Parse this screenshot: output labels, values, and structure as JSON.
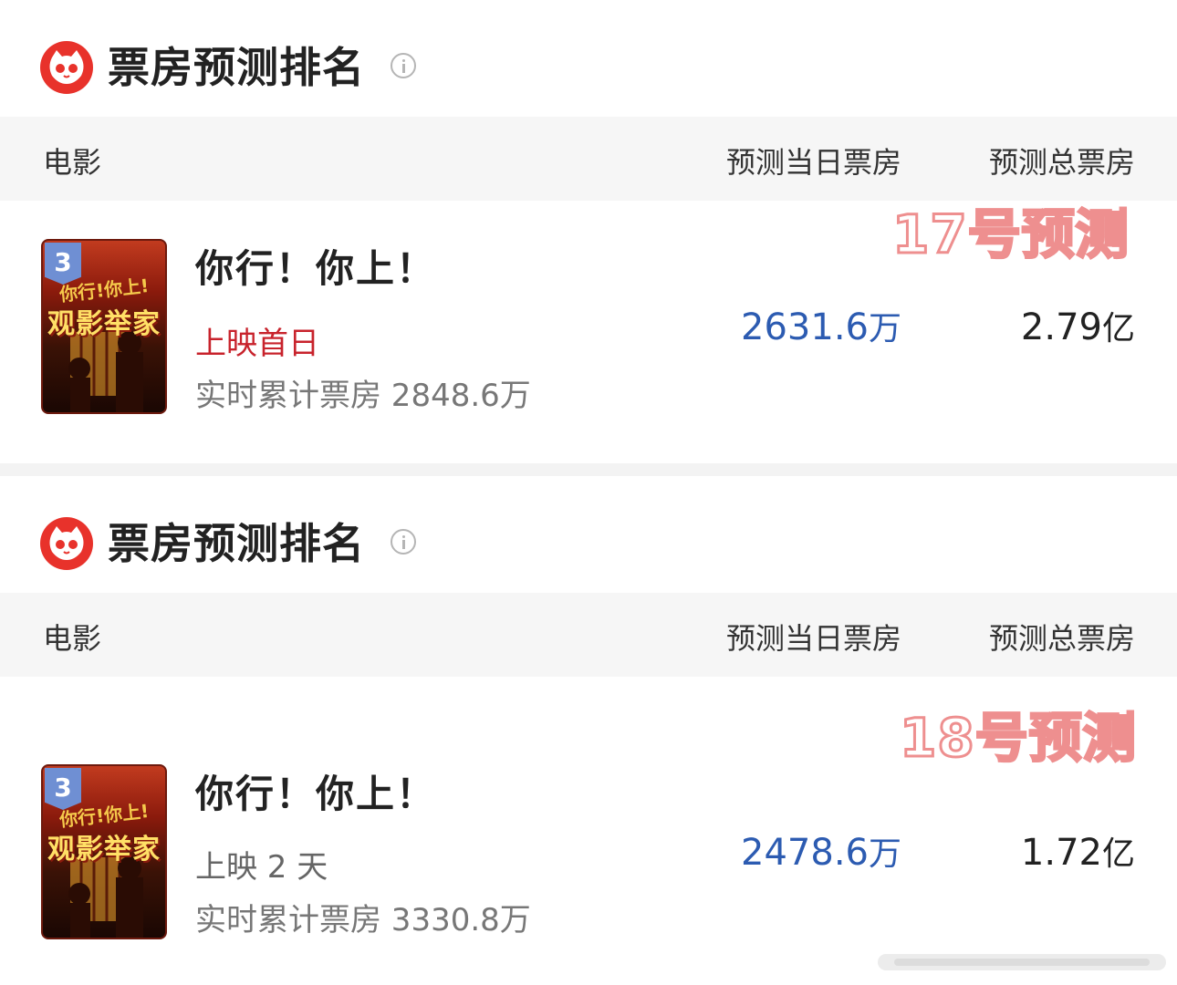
{
  "sections": [
    {
      "title": "票房预测排名",
      "headers": {
        "movie": "电影",
        "daily": "预测当日票房",
        "total": "预测总票房"
      },
      "annotation": "17号预测",
      "row": {
        "rank": "3",
        "poster_small_text": "你行!你上!",
        "poster_main_text": "观影举家",
        "name": "你行！你上！",
        "status": "上映首日",
        "cumulative": "实时累计票房 2848.6万",
        "daily_value": "2631.6",
        "daily_unit": "万",
        "total_value": "2.79",
        "total_unit": "亿"
      }
    },
    {
      "title": "票房预测排名",
      "headers": {
        "movie": "电影",
        "daily": "预测当日票房",
        "total": "预测总票房"
      },
      "annotation": "18号预测",
      "row": {
        "rank": "3",
        "poster_small_text": "你行!你上!",
        "poster_main_text": "观影举家",
        "name": "你行！你上！",
        "status": "上映 2 天",
        "cumulative": "实时累计票房 3330.8万",
        "daily_value": "2478.6",
        "daily_unit": "万",
        "total_value": "1.72",
        "total_unit": "亿"
      }
    }
  ],
  "colors": {
    "brand_red": "#e8322b",
    "status_red": "#c8232c",
    "daily_blue": "#2c5bb1",
    "rank_badge": "#6f8fd3",
    "annotation_stroke": "#ee8f8f"
  },
  "icons": {
    "logo": "cat-logo-icon",
    "info": "info-icon"
  }
}
